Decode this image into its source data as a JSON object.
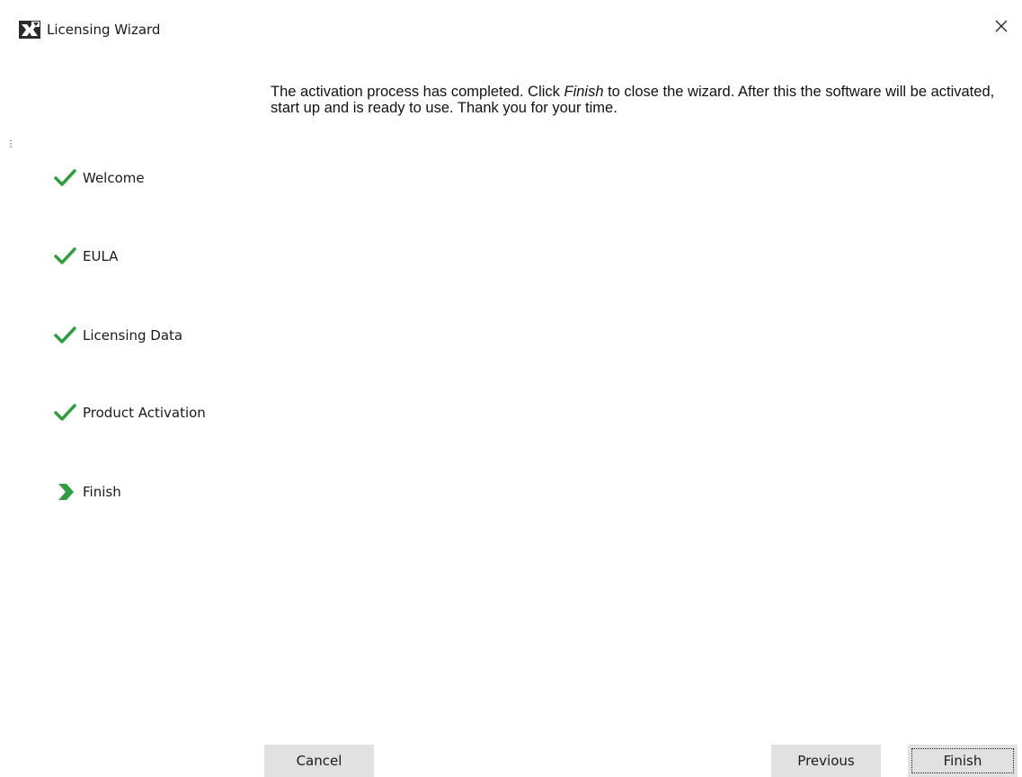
{
  "window": {
    "title": "Licensing Wizard"
  },
  "steps": [
    {
      "label": "Welcome",
      "status": "done",
      "icon": "checkmark-icon"
    },
    {
      "label": "EULA",
      "status": "done",
      "icon": "checkmark-icon"
    },
    {
      "label": "Licensing Data",
      "status": "done",
      "icon": "checkmark-icon"
    },
    {
      "label": "Product Activation",
      "status": "done",
      "icon": "checkmark-icon"
    },
    {
      "label": "Finish",
      "status": "current",
      "icon": "chevron-right-icon"
    }
  ],
  "message": {
    "before": "The activation process has completed. Click ",
    "emphasis": "Finish",
    "after": " to close the wizard. After this the software will be activated, start up and is ready to use. Thank you for your time."
  },
  "buttons": {
    "cancel": "Cancel",
    "previous": "Previous",
    "finish": "Finish"
  },
  "colors": {
    "accent_green": "#2e9e3e",
    "button_bg": "#e1e1e1"
  }
}
